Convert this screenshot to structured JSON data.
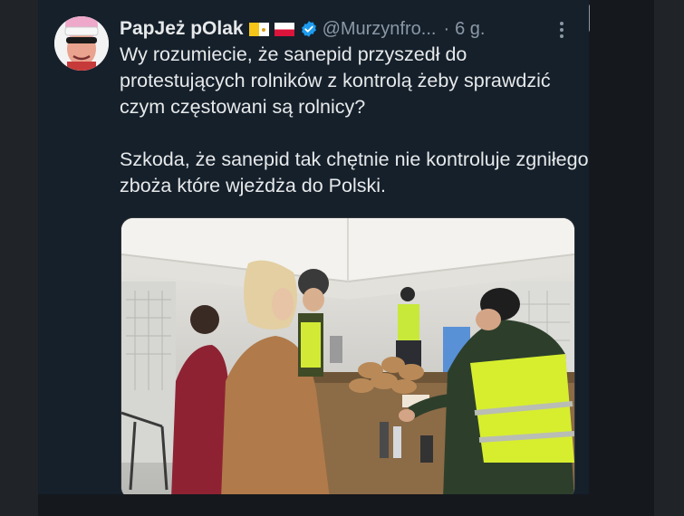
{
  "tweet": {
    "display_name": "PapJeż pOlak",
    "handle": "@Murzynfro...",
    "separator": "·",
    "time": "6 g.",
    "paragraphs": [
      "Wy rozumiecie, że sanepid przyszedł do protestujących rolników z kontrolą żeby sprawdzić czym częstowani są rolnicy?",
      "Szkoda, że sanepid tak chętnie nie kontroluje zgniłego zboża które wjeżdża do Polski."
    ],
    "badges": [
      "flag-vatican-icon",
      "flag-poland-icon",
      "verified-badge-icon"
    ]
  },
  "colors": {
    "background": "#15202b",
    "text": "#e7e9ea",
    "secondary_text": "#8b98a5",
    "verified": "#1d9bf0"
  }
}
